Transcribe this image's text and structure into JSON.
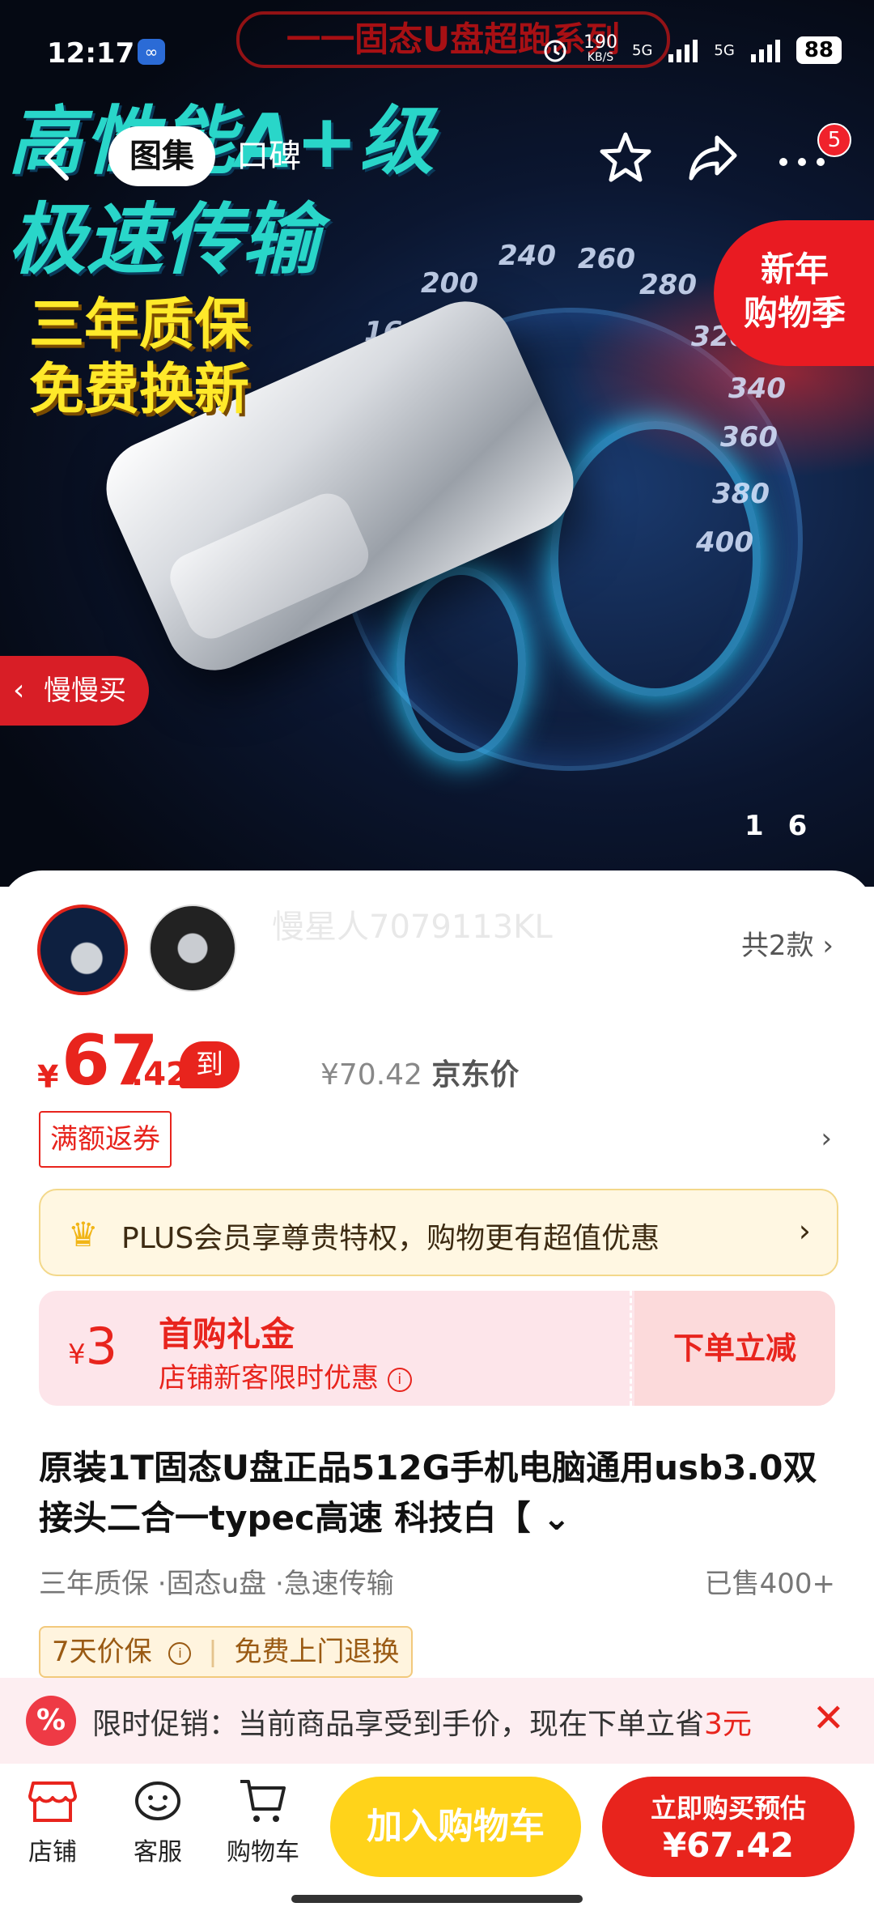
{
  "status_bar": {
    "time": "12:17",
    "app_badge": "∞",
    "speed": "190",
    "speed_unit": "KB/S",
    "net1": "5G",
    "net2": "5G",
    "battery": "88"
  },
  "hero_ad": {
    "banner": "一一固态U盘超跑系列",
    "line1": "高性能A+级",
    "line2": "极速传输",
    "line3": "三年质保",
    "line4": "免费换新",
    "dial_numbers": [
      "200",
      "240",
      "260",
      "280",
      "160",
      "320",
      "340",
      "360",
      "380",
      "400"
    ]
  },
  "top_nav": {
    "tab_gallery": "图集",
    "tab_reviews": "口碑",
    "more_badge": "5"
  },
  "new_year_tag": {
    "line1": "新年",
    "line2": "购物季"
  },
  "slow_buy": "慢慢买",
  "pager": {
    "current": "1",
    "total": "6"
  },
  "variants": {
    "watermark": "慢星人7079113KL",
    "count_label": "共2款"
  },
  "price": {
    "currency": "¥",
    "integer": "67",
    "decimal": ".42",
    "tag": "到手价",
    "jd_price": "¥70.42",
    "jd_label": "京东价"
  },
  "coupon": {
    "label": "满额返券"
  },
  "plus": {
    "text": "PLUS会员享尊贵特权，购物更有超值优惠"
  },
  "gift": {
    "currency": "¥",
    "amount": "3",
    "title": "首购礼金",
    "subtitle": "店铺新客限时优惠",
    "button": "下单立减"
  },
  "product": {
    "title": "原装1T固态U盘正品512G手机电脑通用usb3.0双接头二合一typec高速 科技白【",
    "tags": "三年质保 ·固态u盘 ·急速传输",
    "sold": "已售400+"
  },
  "assurance": {
    "item1": "7天价保",
    "item2": "免费上门退换"
  },
  "promo": {
    "text_prefix": "限时促销：当前商品享受到手价，现在下单立省",
    "amount": "3元"
  },
  "bottom_bar": {
    "store": "店铺",
    "service": "客服",
    "cart": "购物车",
    "add_to_cart": "加入购物车",
    "buy_now": "立即购买预估",
    "buy_price": "¥67.42"
  },
  "colors": {
    "accent": "#e8241d",
    "cart_button": "#ffd31a",
    "plus_bg": "#fff7e2",
    "gift_bg": "#fde5ea"
  }
}
